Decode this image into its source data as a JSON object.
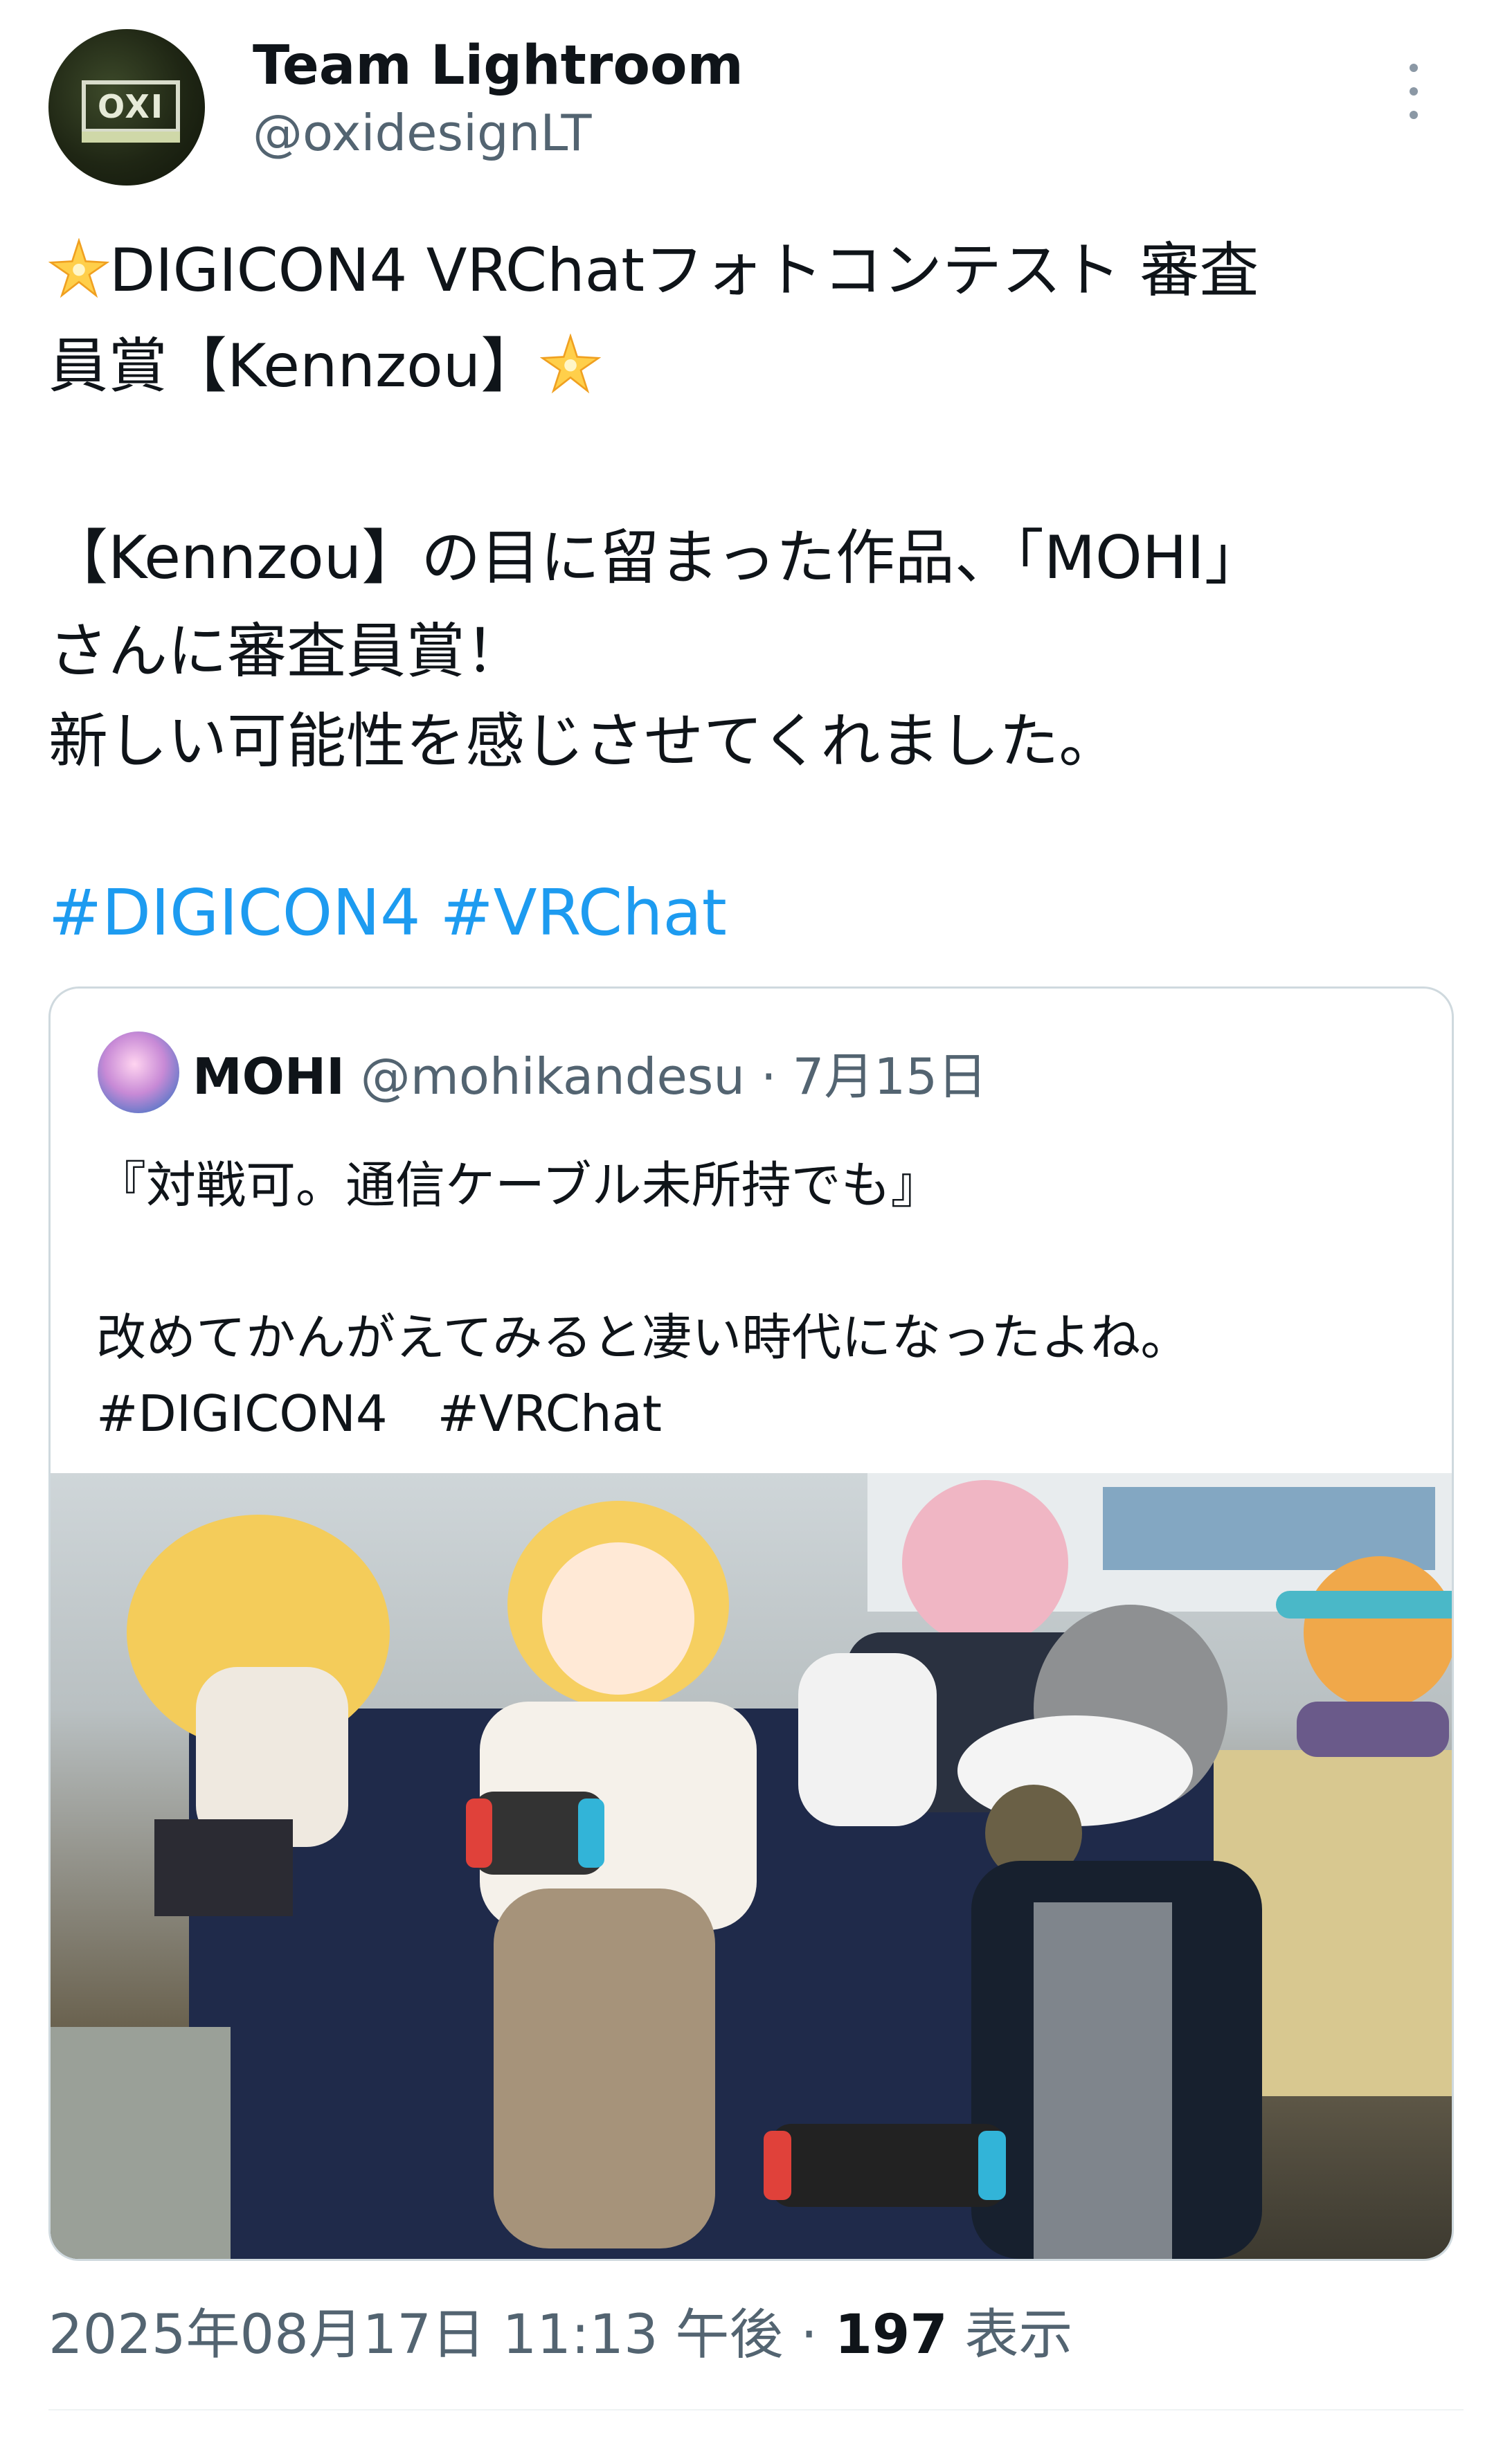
{
  "author": {
    "name": "Team Lightroom",
    "handle": "@oxidesignLT",
    "avatar_logo": "OXI"
  },
  "tweet": {
    "line1": "DIGICON4 VRChatフォトコンテスト 審査",
    "line2": "員賞【Kennzou】",
    "line3": "【Kennzou】の目に留まった作品、「MOHI」",
    "line4": "さんに審査員賞！",
    "line5": "新しい可能性を感じさせてくれました。",
    "hashtags": [
      "#DIGICON4",
      "#VRChat"
    ]
  },
  "quoted": {
    "name": "MOHI",
    "handle": "@mohikandesu",
    "date_separator": "·",
    "date": "7月15日",
    "line1": "『対戦可。通信ケーブル未所持でも』",
    "line2": "改めてかんがえてみると凄い時代になったよね。",
    "line3": "#DIGICON4　#VRChat"
  },
  "footer": {
    "timestamp": "2025年08月17日 11:13 午後",
    "separator": "·",
    "views": "197",
    "views_label": "表示"
  },
  "icons": [
    "more-vertical-icon",
    "sparkle-star-icon"
  ]
}
